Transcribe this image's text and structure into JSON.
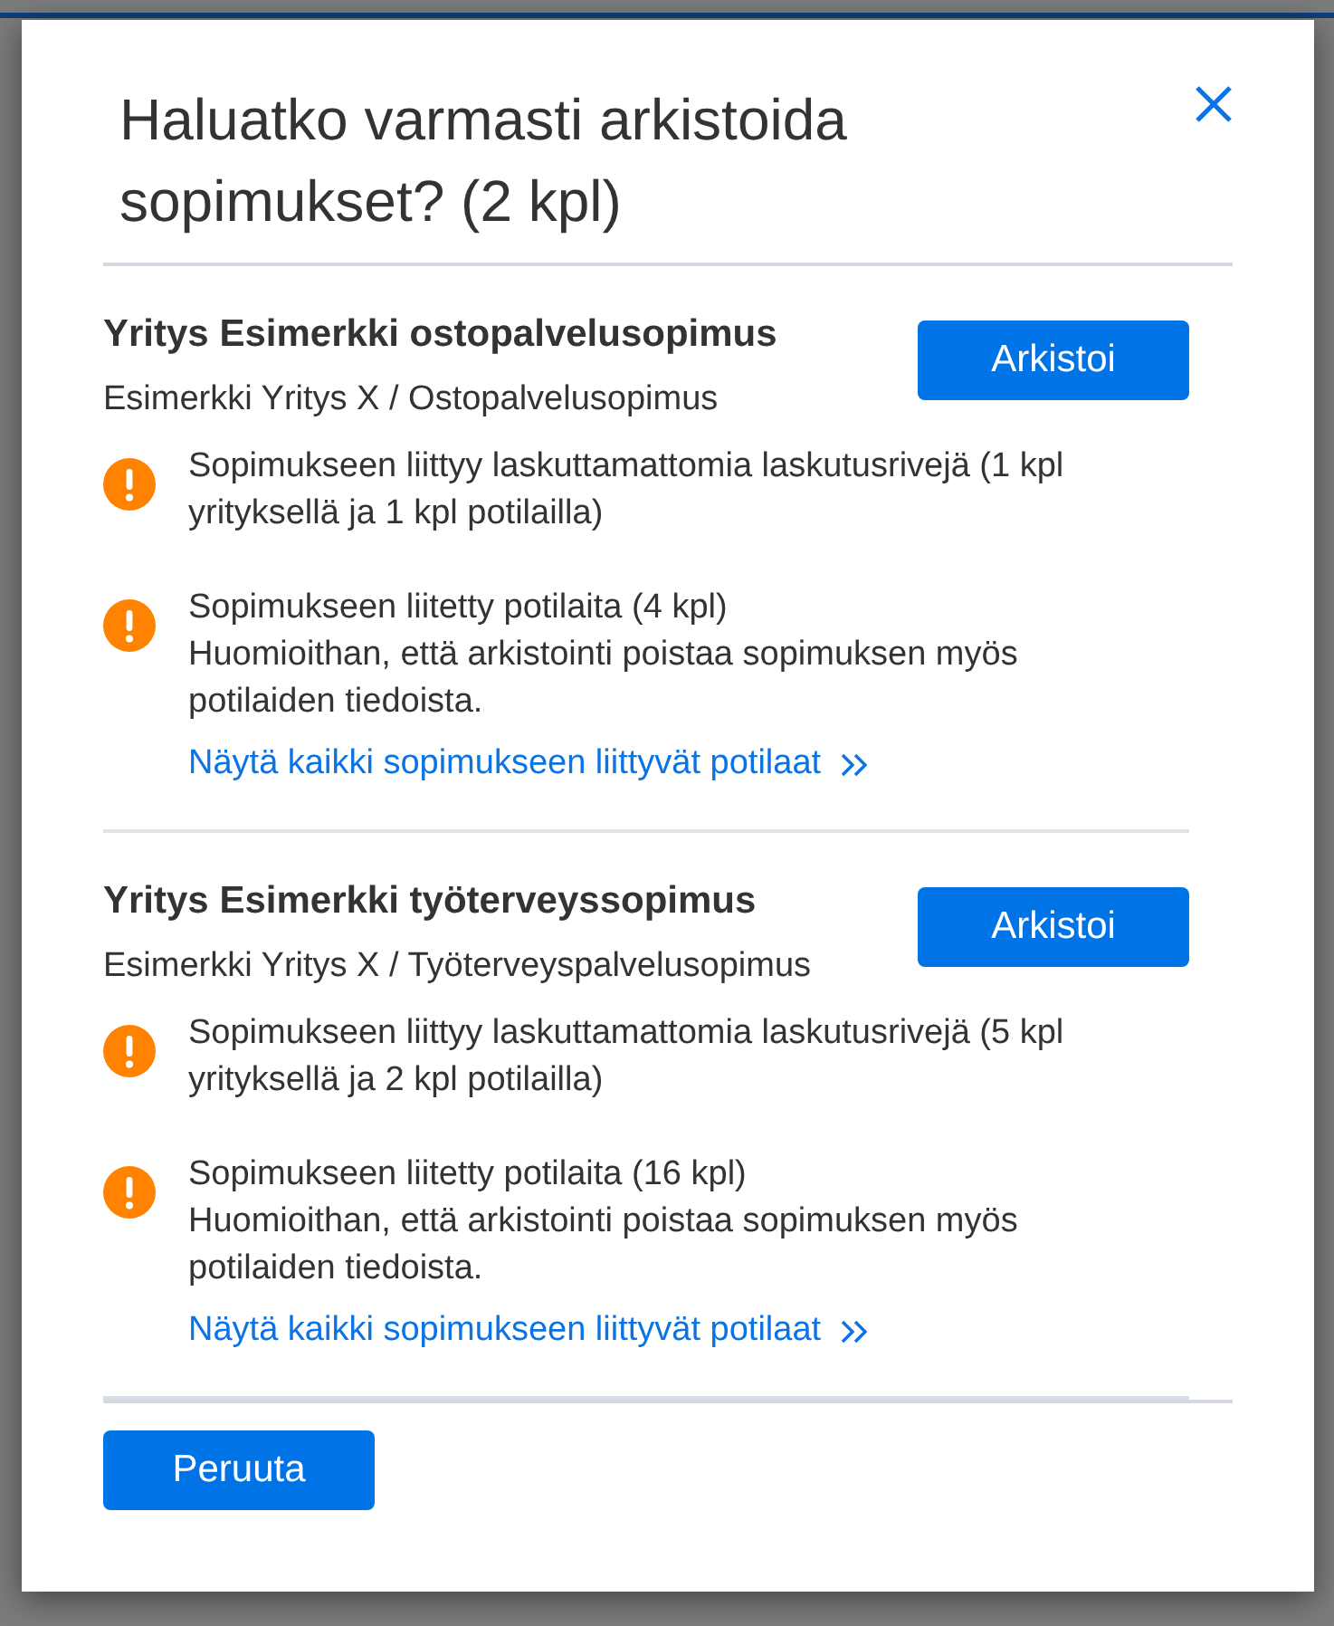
{
  "dialog": {
    "title": "Haluatko varmasti arkistoida sopimukset? (2 kpl)"
  },
  "contracts": [
    {
      "title": "Yritys Esimerkki ostopalvelusopimus",
      "subtitle": "Esimerkki Yritys X / Ostopalvelusopimus",
      "archive_button": "Arkistoi",
      "warnings": [
        {
          "lines": [
            "Sopimukseen liittyy laskuttamattomia laskutusrivejä (1 kpl yrityksellä ja 1 kpl potilailla)"
          ]
        },
        {
          "lines": [
            "Sopimukseen liitetty potilaita (4 kpl)",
            "Huomioithan, että arkistointi poistaa sopimuksen myös potilaiden tiedoista."
          ],
          "link": "Näytä kaikki sopimukseen liittyvät potilaat"
        }
      ]
    },
    {
      "title": "Yritys Esimerkki työterveyssopimus",
      "subtitle": "Esimerkki Yritys X / Työterveyspalvelusopimus",
      "archive_button": "Arkistoi",
      "warnings": [
        {
          "lines": [
            "Sopimukseen liittyy laskuttamattomia laskutusrivejä (5 kpl yrityksellä ja 2 kpl potilailla)"
          ]
        },
        {
          "lines": [
            "Sopimukseen liitetty potilaita (16 kpl)",
            "Huomioithan, että arkistointi poistaa sopimuksen myös potilaiden tiedoista."
          ],
          "link": "Näytä kaikki sopimukseen liittyvät potilaat"
        }
      ]
    }
  ],
  "footer": {
    "cancel_button": "Peruuta"
  }
}
